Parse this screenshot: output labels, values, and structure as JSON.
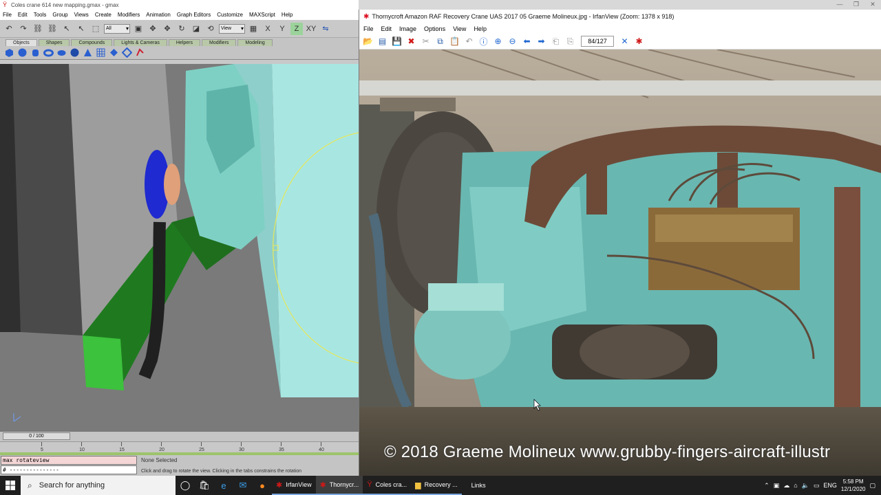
{
  "gmax": {
    "title": "Coles crane 614 new mapping.gmax - gmax",
    "menu": [
      "File",
      "Edit",
      "Tools",
      "Group",
      "Views",
      "Create",
      "Modifiers",
      "Animation",
      "Graph Editors",
      "Customize",
      "MAXScript",
      "Help"
    ],
    "filter_select": "All",
    "view_select": "View",
    "tabs": [
      "Objects",
      "Shapes",
      "Compounds",
      "Lights & Cameras",
      "Helpers",
      "Modifiers",
      "Modeling"
    ],
    "active_tab": "Objects",
    "time_slider": "0 / 100",
    "ruler_labels": [
      "5",
      "10",
      "15",
      "20",
      "25",
      "30",
      "35",
      "40"
    ],
    "maxscript_line1": "max rotateview",
    "maxscript_line2": "# ---------------",
    "selection_status": "None Selected",
    "prompt": "Click and drag to rotate the view.  Clicking in the tabs constrains the rotation"
  },
  "irfan": {
    "title": "Thornycroft Amazon RAF Recovery Crane UAS 2017 05 Graeme Molineux.jpg - IrfanView (Zoom: 1378 x 918)",
    "menu": [
      "File",
      "Edit",
      "Image",
      "Options",
      "View",
      "Help"
    ],
    "page_counter": "84/127",
    "watermark": "© 2018 Graeme Molineux www.grubby-fingers-aircraft-illustr"
  },
  "taskbar": {
    "search_placeholder": "Search for anything",
    "tasks": [
      {
        "label": "IrfanView",
        "icon": "irfanview-icon"
      },
      {
        "label": "Thornycr...",
        "icon": "irfanview-icon"
      },
      {
        "label": "Coles cra...",
        "icon": "gmax-icon"
      },
      {
        "label": "Recovery ...",
        "icon": "folder-icon"
      }
    ],
    "links_label": "Links",
    "language": "ENG",
    "time": "5:58 PM",
    "date": "12/1/2020"
  },
  "colors": {
    "taskbar_bg": "#1f1f1f",
    "gmax_bg": "#c8c8c8",
    "viewport_bg": "#797979",
    "accent_blue": "#7aa7e0"
  }
}
